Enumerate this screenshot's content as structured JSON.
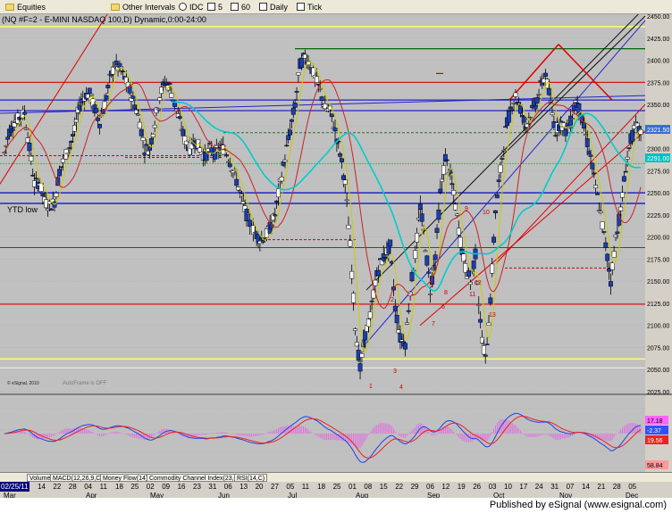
{
  "toolbar": {
    "symbol_label": "Equities",
    "intervals_label": "Other Intervals",
    "idc_label": "IDC",
    "int1": "5",
    "int2": "60",
    "daily_label": "Daily",
    "tick_label": "Tick"
  },
  "chart": {
    "title": "(NQ #F=2 - E-MINI NASDAQ 100,D) Dynamic,0:00-24:00",
    "ytd_low_label": "YTD low",
    "copyright": "© eSignal, 2010",
    "autoframe": "AutoFrame is OFF",
    "price_labels": [
      "2450.00",
      "2425.00",
      "2400.00",
      "2375.00",
      "2350.00",
      "2325.00",
      "2300.00",
      "2275.00",
      "2250.00",
      "2225.00",
      "2200.00",
      "2175.00",
      "2150.00",
      "2125.00",
      "2100.00",
      "2075.00",
      "2050.00",
      "2025.00"
    ],
    "last_price": "2321.50",
    "cyan_value": "2291.00",
    "sequence_numbers": [
      "1",
      "2",
      "3",
      "4",
      "5",
      "6",
      "7",
      "8",
      "9",
      "10",
      "11",
      "12",
      "13"
    ]
  },
  "indicator": {
    "hist_value": "17.18",
    "macd_value": "-2.37",
    "signal_value": "19.56",
    "bottom_value": "58.84"
  },
  "tabs": [
    "Volume",
    "MACD(12,26,9,C)",
    "Money Flow(14)",
    "Commodity Channel Index(23,C)",
    "RSI(14,C)"
  ],
  "dates": {
    "start": "02/25/11",
    "days": [
      "14",
      "22",
      "28",
      "04",
      "11",
      "18",
      "25",
      "02",
      "09",
      "16",
      "23",
      "31",
      "06",
      "13",
      "20",
      "27",
      "05",
      "11",
      "18",
      "25",
      "01",
      "08",
      "15",
      "22",
      "29",
      "06",
      "12",
      "19",
      "26",
      "03",
      "10",
      "17",
      "24",
      "31",
      "07",
      "14",
      "21",
      "28",
      "05"
    ],
    "months": [
      "Mar",
      "Apr",
      "May",
      "Jun",
      "Jul",
      "Aug",
      "Sep",
      "Oct",
      "Nov",
      "Dec"
    ]
  },
  "footer": "Published by eSignal (www.esignal.com)",
  "chart_data": {
    "type": "candlestick",
    "title": "(NQ #F=2 - E-MINI NASDAQ 100,D) Dynamic,0:00-24:00",
    "ylim": [
      2025,
      2450
    ],
    "price_anchors": [
      [
        0,
        2295
      ],
      [
        3,
        2320
      ],
      [
        6,
        2330
      ],
      [
        9,
        2335
      ],
      [
        12,
        2340
      ],
      [
        15,
        2300
      ],
      [
        18,
        2260
      ],
      [
        21,
        2262
      ],
      [
        24,
        2240
      ],
      [
        27,
        2235
      ],
      [
        30,
        2240
      ],
      [
        33,
        2275
      ],
      [
        36,
        2290
      ],
      [
        39,
        2302
      ],
      [
        42,
        2320
      ],
      [
        45,
        2350
      ],
      [
        48,
        2360
      ],
      [
        51,
        2362
      ],
      [
        54,
        2345
      ],
      [
        57,
        2330
      ],
      [
        60,
        2350
      ],
      [
        63,
        2378
      ],
      [
        66,
        2395
      ],
      [
        69,
        2390
      ],
      [
        72,
        2380
      ],
      [
        75,
        2365
      ],
      [
        78,
        2350
      ],
      [
        81,
        2330
      ],
      [
        84,
        2300
      ],
      [
        87,
        2300
      ],
      [
        90,
        2330
      ],
      [
        93,
        2360
      ],
      [
        96,
        2375
      ],
      [
        99,
        2370
      ],
      [
        102,
        2350
      ],
      [
        105,
        2330
      ],
      [
        108,
        2310
      ],
      [
        111,
        2300
      ],
      [
        114,
        2310
      ],
      [
        117,
        2300
      ],
      [
        120,
        2290
      ],
      [
        123,
        2300
      ],
      [
        126,
        2295
      ],
      [
        129,
        2300
      ],
      [
        132,
        2300
      ],
      [
        135,
        2285
      ],
      [
        138,
        2270
      ],
      [
        141,
        2250
      ],
      [
        144,
        2230
      ],
      [
        147,
        2215
      ],
      [
        150,
        2205
      ],
      [
        153,
        2198
      ],
      [
        156,
        2200
      ],
      [
        159,
        2210
      ],
      [
        162,
        2225
      ],
      [
        165,
        2260
      ],
      [
        168,
        2290
      ],
      [
        171,
        2320
      ],
      [
        174,
        2350
      ],
      [
        177,
        2395
      ],
      [
        180,
        2405
      ],
      [
        183,
        2395
      ],
      [
        186,
        2380
      ],
      [
        189,
        2365
      ],
      [
        192,
        2345
      ],
      [
        195,
        2342
      ],
      [
        198,
        2320
      ],
      [
        201,
        2295
      ],
      [
        204,
        2260
      ],
      [
        207,
        2190
      ],
      [
        210,
        2100
      ],
      [
        213,
        2050
      ],
      [
        216,
        2090
      ],
      [
        219,
        2110
      ],
      [
        222,
        2150
      ],
      [
        225,
        2170
      ],
      [
        228,
        2180
      ],
      [
        231,
        2190
      ],
      [
        234,
        2120
      ],
      [
        237,
        2085
      ],
      [
        240,
        2080
      ],
      [
        243,
        2140
      ],
      [
        246,
        2180
      ],
      [
        249,
        2235
      ],
      [
        252,
        2190
      ],
      [
        255,
        2140
      ],
      [
        258,
        2180
      ],
      [
        261,
        2250
      ],
      [
        264,
        2290
      ],
      [
        267,
        2270
      ],
      [
        270,
        2235
      ],
      [
        273,
        2195
      ],
      [
        276,
        2165
      ],
      [
        279,
        2150
      ],
      [
        282,
        2180
      ],
      [
        285,
        2100
      ],
      [
        288,
        2060
      ],
      [
        291,
        2130
      ],
      [
        294,
        2230
      ],
      [
        297,
        2275
      ],
      [
        300,
        2320
      ],
      [
        303,
        2345
      ],
      [
        306,
        2360
      ],
      [
        309,
        2345
      ],
      [
        312,
        2325
      ],
      [
        315,
        2340
      ],
      [
        318,
        2350
      ],
      [
        321,
        2370
      ],
      [
        324,
        2385
      ],
      [
        327,
        2350
      ],
      [
        330,
        2320
      ],
      [
        333,
        2330
      ],
      [
        336,
        2320
      ],
      [
        339,
        2330
      ],
      [
        342,
        2355
      ],
      [
        345,
        2340
      ],
      [
        348,
        2315
      ],
      [
        351,
        2290
      ],
      [
        354,
        2255
      ],
      [
        357,
        2225
      ],
      [
        360,
        2190
      ],
      [
        363,
        2150
      ],
      [
        366,
        2200
      ],
      [
        369,
        2230
      ],
      [
        372,
        2280
      ],
      [
        375,
        2310
      ],
      [
        378,
        2325
      ],
      [
        381,
        2318
      ]
    ]
  }
}
